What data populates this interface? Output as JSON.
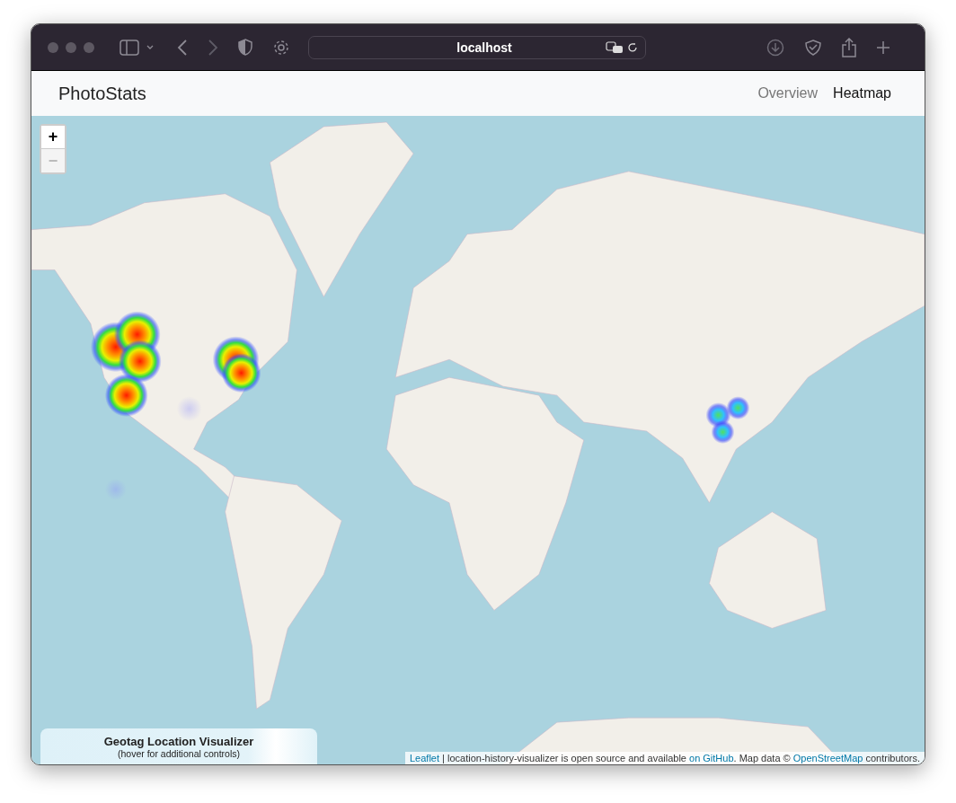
{
  "browser": {
    "address": "localhost"
  },
  "navbar": {
    "brand": "PhotoStats",
    "links": [
      {
        "label": "Overview",
        "selected": false
      },
      {
        "label": "Heatmap",
        "selected": true
      }
    ]
  },
  "map": {
    "zoom_buttons": [
      {
        "label": "+",
        "disabled": false
      },
      {
        "label": "−",
        "disabled": true
      }
    ],
    "info_panel": {
      "title": "Geotag Location Visualizer",
      "subtitle": "(hover for additional controls)"
    },
    "attribution": [
      {
        "kind": "link",
        "text": "Leaflet"
      },
      {
        "kind": "plain",
        "text": " | location-history-visualizer is open source and available "
      },
      {
        "kind": "link",
        "text": "on GitHub"
      },
      {
        "kind": "plain",
        "text": ". Map data © "
      },
      {
        "kind": "link",
        "text": "OpenStreetMap"
      },
      {
        "kind": "plain",
        "text": " contributors."
      }
    ]
  }
}
